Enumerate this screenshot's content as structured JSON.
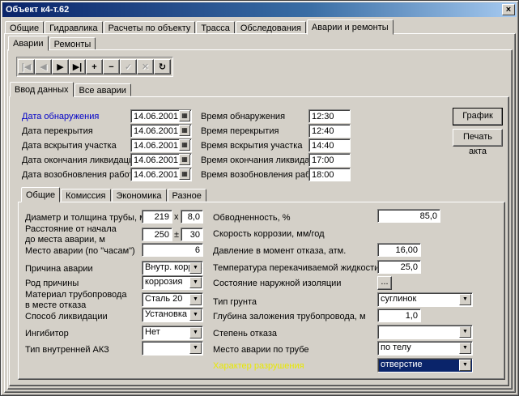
{
  "window": {
    "title": "Объект к4-т.62",
    "close_glyph": "×"
  },
  "main_tabs": [
    "Общие",
    "Гидравлика",
    "Расчеты по объекту",
    "Трасса",
    "Обследования",
    "Аварии и ремонты"
  ],
  "sub_tabs": [
    "Аварии",
    "Ремонты"
  ],
  "toolbar": {
    "buttons": [
      {
        "icon": "first-record-icon",
        "glyph": "|◀",
        "enabled": false
      },
      {
        "icon": "prior-record-icon",
        "glyph": "◀",
        "enabled": false
      },
      {
        "icon": "next-record-icon",
        "glyph": "▶",
        "enabled": true
      },
      {
        "icon": "last-record-icon",
        "glyph": "▶|",
        "enabled": true
      },
      {
        "icon": "insert-record-icon",
        "glyph": "+",
        "enabled": true
      },
      {
        "icon": "delete-record-icon",
        "glyph": "−",
        "enabled": true
      },
      {
        "icon": "post-record-icon",
        "glyph": "✓",
        "enabled": false
      },
      {
        "icon": "cancel-record-icon",
        "glyph": "✕",
        "enabled": false
      },
      {
        "icon": "refresh-icon",
        "glyph": "↻",
        "enabled": true
      }
    ]
  },
  "entry_tabs": [
    "Ввод данных",
    "Все аварии"
  ],
  "dates": [
    {
      "label": "Дата обнаружения",
      "date": "14.06.2001",
      "time_label": "Время обнаружения",
      "time": "12:30"
    },
    {
      "label": "Дата перекрытия",
      "date": "14.06.2001",
      "time_label": "Время перекрытия",
      "time": "12:40"
    },
    {
      "label": "Дата вскрытия участка",
      "date": "14.06.2001",
      "time_label": "Время вскрытия участка",
      "time": "14:40"
    },
    {
      "label": "Дата окончания ликвидации",
      "date": "14.06.2001",
      "time_label": "Время окончания ликвидации",
      "time": "17:00"
    },
    {
      "label": "Дата возобновления работы",
      "date": "14.06.2001",
      "time_label": "Время возобновления работы",
      "time": "18:00"
    }
  ],
  "calendar_glyph": "▦",
  "buttons": {
    "chart": "График",
    "print": "Печать акта"
  },
  "detail_tabs": [
    "Общие",
    "Комиссия",
    "Экономика",
    "Разное"
  ],
  "left": {
    "diameter_label": "Диаметр и толщина трубы, мм",
    "diameter": "219",
    "x_sep": "x",
    "thickness": "8,0",
    "distance_label": "Расстояние от начала\nдо места аварии, м",
    "distance": "250",
    "pm_sep": "±",
    "distance_tol": "30",
    "place_hours_label": "Место аварии (по \"часам\")",
    "place_hours": "6",
    "cause_label": "Причина аварии",
    "cause": "Внутр. корроз",
    "cause_type_label": "Род причины",
    "cause_type": "коррозия",
    "material_label": "Материал трубопровода\nв месте отказа",
    "material": "Сталь 20",
    "method_label": "Способ ликвидации",
    "method": "Установка хо",
    "inhibitor_label": "Ингибитор",
    "inhibitor": "Нет",
    "akz_label": "Тип внутренней АКЗ",
    "akz": ""
  },
  "right": {
    "watercut_label": "Обводненность, %",
    "watercut": "85,0",
    "corrosion_label": "Скорость коррозии, мм/год",
    "corrosion": "",
    "pressure_label": "Давление в момент отказа, атм.",
    "pressure": "16,00",
    "temp_label": "Температура перекачиваемой жидкости, С",
    "temp": "25,0",
    "insulation_label": "Состояние наружной изоляции",
    "insulation_btn": "...",
    "soil_label": "Тип грунта",
    "soil": "суглинок",
    "depth_label": "Глубина заложения трубопровода, м",
    "depth": "1,0",
    "degree_label": "Степень отказа",
    "degree": "",
    "place_label": "Место аварии по трубе",
    "place": "по телу",
    "nature_label": "Характер разрушения",
    "nature": "отверстие"
  }
}
